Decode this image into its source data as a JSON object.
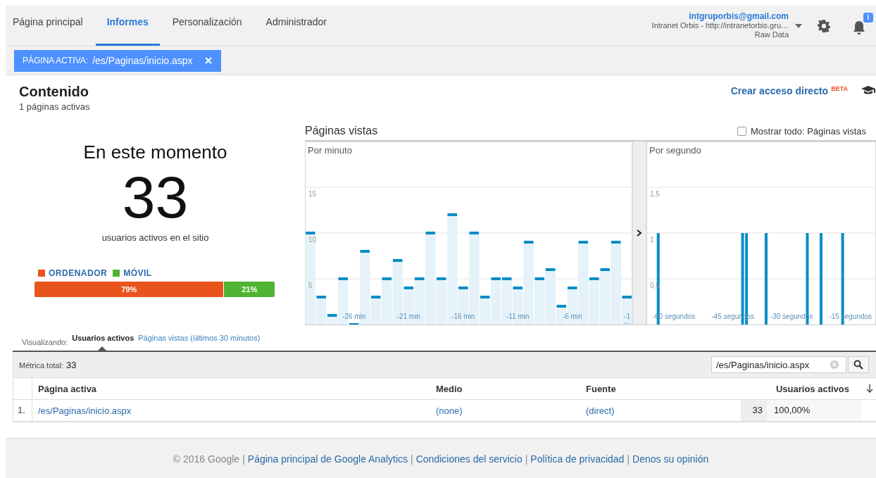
{
  "nav": {
    "tabs": [
      {
        "label": "Página principal",
        "selected": false
      },
      {
        "label": "Informes",
        "selected": true
      },
      {
        "label": "Personalización",
        "selected": false
      },
      {
        "label": "Administrador",
        "selected": false
      }
    ],
    "account": {
      "email": "intgruporbis@gmail.com",
      "property": "Intranet Orbis - http://intranetorbis.gru…",
      "view": "Raw Data"
    },
    "notification_badge": "i"
  },
  "filter": {
    "label": "PÁGINA ACTIVA:",
    "value": "/es/Paginas/inicio.aspx"
  },
  "header": {
    "title": "Contenido",
    "subtitle": "1 páginas activas",
    "shortcut": "Crear acceso directo",
    "shortcut_badge": "BETA"
  },
  "now": {
    "heading": "En este momento",
    "count": "33",
    "caption": "usuarios activos en el sitio",
    "devices": [
      {
        "name": "ORDENADOR",
        "color": "#e8541c",
        "level": 0.79,
        "percent": "79%"
      },
      {
        "name": "MÓVIL",
        "color": "#50b432",
        "level": 0.21,
        "percent": "21%"
      }
    ]
  },
  "pageviews": {
    "title": "Páginas vistas",
    "show_all": {
      "label": "Mostrar todo: Páginas vistas",
      "checked": false
    },
    "per_minute": {
      "title": "Por minuto",
      "overflow_mark": "…",
      "chart_data": {
        "type": "bar",
        "grid": true,
        "ylim": [
          0,
          20
        ],
        "x": [
          -30,
          -29,
          -28,
          -27,
          -26,
          -25,
          -24,
          -23,
          -22,
          -21,
          -20,
          -19,
          -18,
          -17,
          -16,
          -15,
          -14,
          -13,
          -12,
          -11,
          -10,
          -9,
          -8,
          -7,
          -6,
          -5,
          -4,
          -3,
          -2,
          -1
        ],
        "values": [
          10,
          3,
          1,
          5,
          0,
          8,
          3,
          5,
          7,
          4,
          5,
          10,
          5,
          12,
          4,
          10,
          3,
          5,
          5,
          4,
          9,
          5,
          6,
          2,
          4,
          9,
          5,
          6,
          9,
          3
        ],
        "xlim": [
          -30.5,
          -0.5
        ],
        "yticks": [
          5,
          10,
          15
        ],
        "xticks": [
          {
            "value": -26,
            "label": "-26 min"
          },
          {
            "value": -21,
            "label": "-21 min"
          },
          {
            "value": -16,
            "label": "-16 min"
          },
          {
            "value": -11,
            "label": "-11 min"
          },
          {
            "value": -6,
            "label": "-6 min"
          },
          {
            "value": -1,
            "label": "-1"
          }
        ]
      }
    },
    "per_second": {
      "title": "Por segundo",
      "chart_data": {
        "type": "bar",
        "grid": true,
        "ylim": [
          0,
          2
        ],
        "x": [
          -64,
          -42.5,
          -41.5,
          -36.5,
          -26,
          -22.5,
          -17
        ],
        "values": [
          1,
          1,
          1,
          1,
          1,
          1,
          1
        ],
        "xlim": [
          -67,
          -8.5
        ],
        "yticks": [
          {
            "value": 0.5,
            "label": "0,5"
          },
          {
            "value": 1,
            "label": "1"
          },
          {
            "value": 1.5,
            "label": "1,5"
          }
        ],
        "xticks": [
          {
            "value": -60,
            "label": "-60 segundos"
          },
          {
            "value": -45,
            "label": "-45 segundos"
          },
          {
            "value": -30,
            "label": "-30 segundos"
          },
          {
            "value": -15,
            "label": "-15 segundos"
          }
        ]
      }
    }
  },
  "viewing": {
    "label": "Visualizando:",
    "options": [
      {
        "label": "Usuarios activos",
        "selected": true
      },
      {
        "label": "Páginas vistas (últimos 30 minutos)",
        "selected": false
      }
    ]
  },
  "table": {
    "metric_label": "Métrica total:",
    "metric_value": "33",
    "search_value": "/es/Paginas/inicio.aspx",
    "columns": [
      "Página activa",
      "Medio",
      "Fuente",
      "Usuarios activos"
    ],
    "rows": [
      {
        "index": "1.",
        "page": "/es/Paginas/inicio.aspx",
        "medium": "(none)",
        "source": "(direct)",
        "users": "33",
        "share": "100,00%"
      }
    ]
  },
  "footer": {
    "copyright": "© 2016 Google",
    "separator": "|",
    "links": [
      "Página principal de Google Analytics",
      "Condiciones del servicio",
      "Política de privacidad",
      "Denos su opinión"
    ]
  }
}
